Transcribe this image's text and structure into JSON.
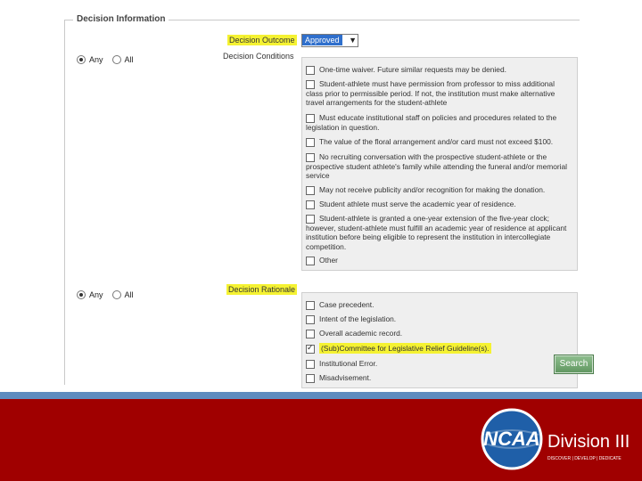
{
  "section": {
    "legend": "Decision Information"
  },
  "outcome": {
    "label": "Decision Outcome",
    "value": "Approved"
  },
  "conditions": {
    "label": "Decision Conditions",
    "radio_any": "Any",
    "radio_all": "All",
    "selected": "Any",
    "items": [
      {
        "text": "One-time waiver. Future similar requests may be denied.",
        "checked": false
      },
      {
        "text": "Student-athlete must have permission from professor to miss additional class prior to permissible period. If not, the institution must make alternative travel arrangements for the student-athlete",
        "checked": false
      },
      {
        "text": "Must educate institutional staff on policies and procedures related to the legislation in question.",
        "checked": false
      },
      {
        "text": "The value of the floral arrangement and/or card must not exceed $100.",
        "checked": false
      },
      {
        "text": "No recruiting conversation with the prospective student-athlete or the prospective student athlete's family while attending the funeral and/or memorial service",
        "checked": false
      },
      {
        "text": "May not receive publicity and/or recognition for making the donation.",
        "checked": false
      },
      {
        "text": "Student athlete must serve the academic year of residence.",
        "checked": false
      },
      {
        "text": "Student-athlete is granted a one-year extension of the five-year clock; however, student-athlete must fulfill an academic year of residence at applicant institution before being eligible to represent the institution in intercollegiate competition.",
        "checked": false
      },
      {
        "text": "Other",
        "checked": false
      }
    ]
  },
  "rationale": {
    "label": "Decision Rationale",
    "radio_any": "Any",
    "radio_all": "All",
    "selected": "Any",
    "items": [
      {
        "text": "Case precedent.",
        "checked": false
      },
      {
        "text": "Intent of the legislation.",
        "checked": false
      },
      {
        "text": "Overall academic record.",
        "checked": false
      },
      {
        "text": "(Sub)Committee for Legislative Relief Guideline(s).",
        "checked": true
      },
      {
        "text": "Institutional Error.",
        "checked": false
      },
      {
        "text": "Misadvisement.",
        "checked": false
      }
    ]
  },
  "search_button": "Search",
  "footer": {
    "logo_text": "NCAA",
    "division": "Division III",
    "tagline": "DISCOVER | DEVELOP | DEDICATE",
    "colors": {
      "band": "#a00000",
      "stripe": "#5e8cbf",
      "logo_blue": "#1f5fa8"
    }
  }
}
